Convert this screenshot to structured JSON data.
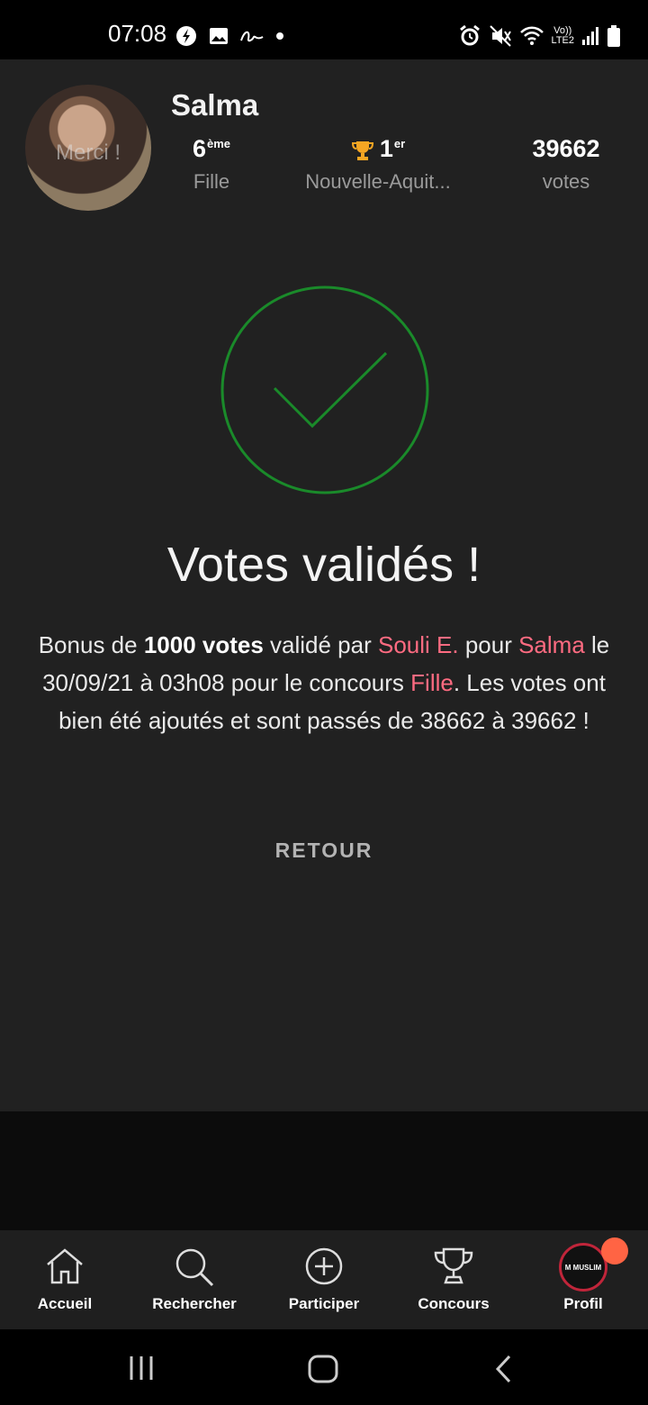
{
  "status_bar": {
    "time": "07:08",
    "left_icons": [
      "flash-icon",
      "image-icon",
      "signature-icon",
      "dot-icon"
    ],
    "right_icons": [
      "alarm-icon",
      "mute-icon",
      "wifi-icon",
      "volte-icon",
      "signal-icon",
      "battery-icon"
    ],
    "volte_line1": "Vo))",
    "volte_line2": "LTE2"
  },
  "profile": {
    "name": "Salma",
    "avatar_overlay": "Merci !",
    "rank_value": "6",
    "rank_suffix": "ème",
    "rank_label": "Fille",
    "region_rank_value": "1",
    "region_rank_suffix": "er",
    "region_label": "Nouvelle-Aquit...",
    "votes_value": "39662",
    "votes_label": "votes"
  },
  "confirmation": {
    "title": "Votes validés !",
    "msg_part1": "Bonus de ",
    "bonus_amount": "1000 votes",
    "msg_part2": " validé par ",
    "voter": "Souli E.",
    "msg_part3": " pour ",
    "candidate": "Salma",
    "msg_part4": " le 30/09/21 à 03h08 pour le concours ",
    "contest": "Fille",
    "msg_part5": ". Les votes ont bien été ajoutés et sont passés de 38662 à 39662 !",
    "back_label": "RETOUR"
  },
  "bottom_nav": {
    "items": [
      {
        "label": "Accueil",
        "icon": "home-icon"
      },
      {
        "label": "Rechercher",
        "icon": "search-icon"
      },
      {
        "label": "Participer",
        "icon": "plus-circle-icon"
      },
      {
        "label": "Concours",
        "icon": "trophy-icon"
      },
      {
        "label": "Profil",
        "icon": "avatar"
      }
    ],
    "profile_avatar_text": "M MUSLIM"
  },
  "colors": {
    "accent": "#ff6b81",
    "success": "#1a8a2a",
    "trophy": "#f5a623",
    "badge": "#ff6444"
  }
}
